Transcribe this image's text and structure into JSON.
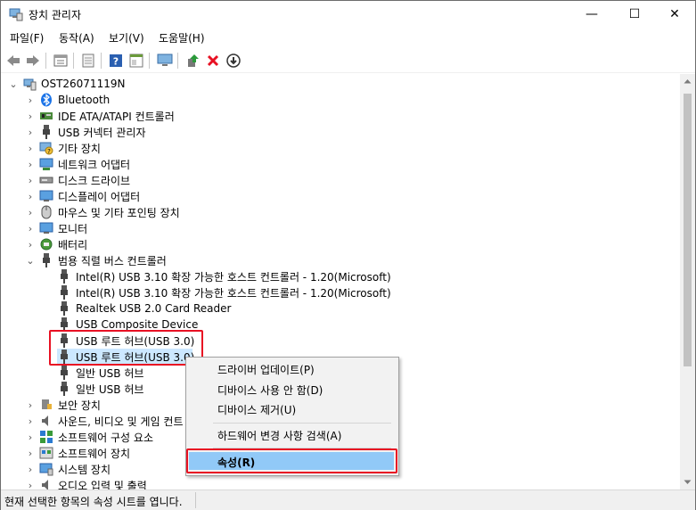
{
  "window": {
    "title": "장치 관리자",
    "minimize_glyph": "—",
    "maximize_glyph": "☐",
    "close_glyph": "✕"
  },
  "menu": [
    "파일(F)",
    "동작(A)",
    "보기(V)",
    "도움말(H)"
  ],
  "toolbar": {
    "icons": [
      "back-arrow-icon",
      "forward-arrow-icon",
      "properties-view-icon",
      "window-icon",
      "help-icon",
      "panel-icon",
      "monitor-scan-icon",
      "update-driver-icon",
      "uninstall-x-icon",
      "download-circle-icon"
    ],
    "uninstall_color": "#e81123"
  },
  "tree": {
    "root": "OST26071119N",
    "categories": [
      {
        "label": "Bluetooth",
        "icon": "bluetooth-icon"
      },
      {
        "label": "IDE ATA/ATAPI 컨트롤러",
        "icon": "ide-controller-icon"
      },
      {
        "label": "USB 커넥터 관리자",
        "icon": "usb-plug-icon"
      },
      {
        "label": "기타 장치",
        "icon": "other-device-icon"
      },
      {
        "label": "네트워크 어댑터",
        "icon": "network-adapter-icon"
      },
      {
        "label": "디스크 드라이브",
        "icon": "disk-drive-icon"
      },
      {
        "label": "디스플레이 어댑터",
        "icon": "display-adapter-icon"
      },
      {
        "label": "마우스 및 기타 포인팅 장치",
        "icon": "mouse-icon"
      },
      {
        "label": "모니터",
        "icon": "monitor-icon"
      },
      {
        "label": "배터리",
        "icon": "battery-icon"
      },
      {
        "label": "범용 직렬 버스 컨트롤러",
        "icon": "usb-plug-icon",
        "expanded": true
      }
    ],
    "usb_children": [
      "Intel(R) USB 3.10 확장 가능한 호스트 컨트롤러 - 1.20(Microsoft)",
      "Intel(R) USB 3.10 확장 가능한 호스트 컨트롤러 - 1.20(Microsoft)",
      "Realtek USB 2.0 Card Reader",
      "USB Composite Device",
      "USB 루트 허브(USB 3.0)",
      "USB 루트 허브(USB 3.0)",
      "일반 USB 허브",
      "일반 USB 허브"
    ],
    "after": [
      {
        "label": "보안 장치",
        "icon": "security-device-icon"
      },
      {
        "label": "사운드, 비디오 및 게임 컨트",
        "icon": "speaker-icon"
      },
      {
        "label": "소프트웨어 구성 요소",
        "icon": "software-component-icon"
      },
      {
        "label": "소프트웨어 장치",
        "icon": "software-device-icon"
      },
      {
        "label": "시스템 장치",
        "icon": "system-device-icon"
      },
      {
        "label": "오디오 입력 및 출력",
        "icon": "audio-io-icon"
      }
    ]
  },
  "context_menu": {
    "items": [
      "드라이버 업데이트(P)",
      "디바이스 사용 안 함(D)",
      "디바이스 제거(U)",
      "하드웨어 변경 사항 검색(A)",
      "속성(R)"
    ],
    "highlight_color": "#91c9f7"
  },
  "status": {
    "text": "현재 선택한 항목의 속성 시트를 엽니다."
  },
  "colors": {
    "selection": "#cce8ff",
    "annotation_red": "#e81123"
  }
}
